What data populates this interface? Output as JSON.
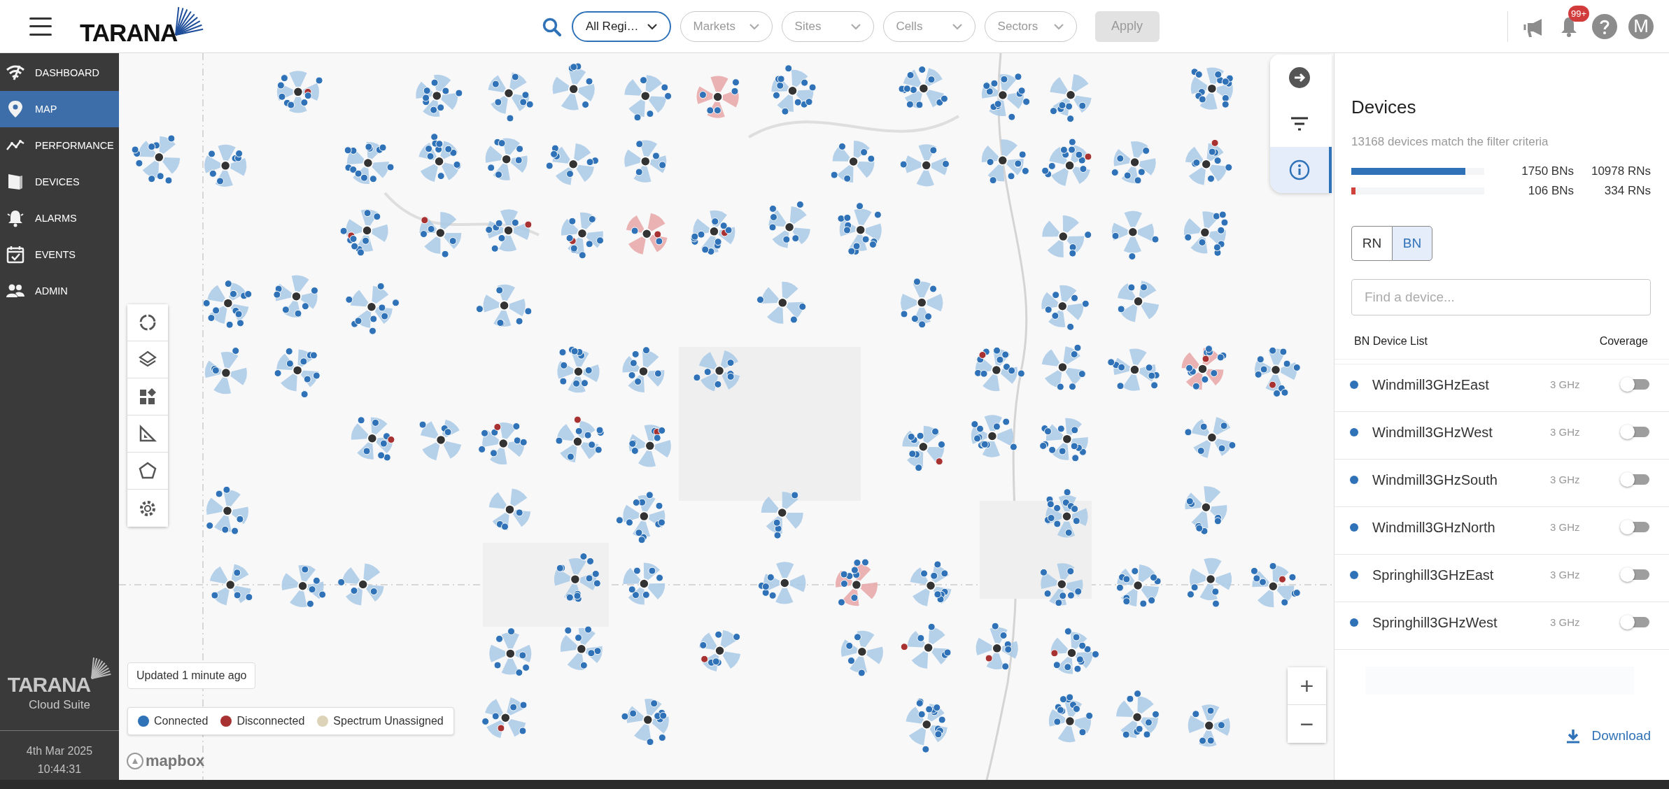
{
  "header": {
    "logo": "TARANA",
    "filters": [
      {
        "label": "All Regi…",
        "selected": true
      },
      {
        "label": "Markets",
        "selected": false
      },
      {
        "label": "Sites",
        "selected": false
      },
      {
        "label": "Cells",
        "selected": false
      },
      {
        "label": "Sectors",
        "selected": false
      }
    ],
    "apply": {
      "label": "Apply",
      "disabled": true
    },
    "notification_badge": "99+",
    "avatar": "M"
  },
  "sidebar": {
    "items": [
      {
        "label": "DASHBOARD",
        "selected": false
      },
      {
        "label": "MAP",
        "selected": true
      },
      {
        "label": "PERFORMANCE",
        "selected": false
      },
      {
        "label": "DEVICES",
        "selected": false
      },
      {
        "label": "ALARMS",
        "selected": false
      },
      {
        "label": "EVENTS",
        "selected": false
      },
      {
        "label": "ADMIN",
        "selected": false
      }
    ],
    "logo": "TARANA",
    "product": "Cloud Suite",
    "date": "4th Mar 2025",
    "time": "10:44:31"
  },
  "map": {
    "updated": "Updated 1 minute ago",
    "legend": [
      {
        "label": "Connected",
        "color": "#2f72b8"
      },
      {
        "label": "Disconnected",
        "color": "#a83232"
      },
      {
        "label": "Spectrum Unassigned",
        "color": "#dcd3b9"
      }
    ],
    "attribution": "mapbox",
    "zoom_in": "+",
    "zoom_out": "−"
  },
  "map_tabs": [
    {
      "selected": false
    },
    {
      "selected": false
    },
    {
      "selected": true
    }
  ],
  "panel": {
    "title": "Devices",
    "summary": "13168 devices match the filter criteria",
    "counts": [
      {
        "level": 0.86,
        "color": "#2f72b8",
        "bns": "1750 BNs",
        "rns": "10978 RNs"
      },
      {
        "level": 0.03,
        "color": "#d0413b",
        "bns": "106 BNs",
        "rns": "334 RNs"
      }
    ],
    "type_toggle": [
      {
        "label": "RN",
        "selected": false
      },
      {
        "label": "BN",
        "selected": true
      }
    ],
    "search": {
      "placeholder": "Find a device..."
    },
    "list_title": "BN Device List",
    "coverage_title": "Coverage",
    "devices": [
      {
        "name": "Windmill3GHzEast",
        "band": "3 GHz",
        "color": "#2f72b8",
        "coverage": false
      },
      {
        "name": "Windmill3GHzWest",
        "band": "3 GHz",
        "color": "#2f72b8",
        "coverage": false
      },
      {
        "name": "Windmill3GHzSouth",
        "band": "3 GHz",
        "color": "#2f72b8",
        "coverage": false
      },
      {
        "name": "Windmill3GHzNorth",
        "band": "3 GHz",
        "color": "#2f72b8",
        "coverage": false
      },
      {
        "name": "Springhill3GHzEast",
        "band": "3 GHz",
        "color": "#2f72b8",
        "coverage": false
      },
      {
        "name": "Springhill3GHzWest",
        "band": "3 GHz",
        "color": "#2f72b8",
        "coverage": false
      }
    ],
    "download": "Download"
  }
}
